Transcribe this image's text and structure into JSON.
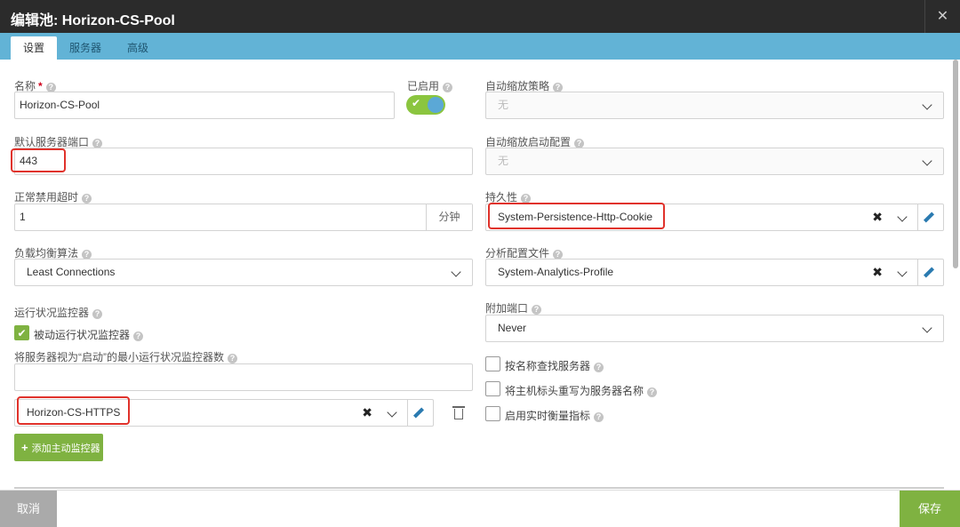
{
  "dialog": {
    "title": "编辑池: Horizon-CS-Pool",
    "close_glyph": "✕"
  },
  "tabs": [
    {
      "label": "设置",
      "active": true
    },
    {
      "label": "服务器",
      "active": false
    },
    {
      "label": "高级",
      "active": false
    }
  ],
  "form": {
    "name": {
      "label": "名称",
      "required_mark": "*",
      "value": "Horizon-CS-Pool"
    },
    "enabled": {
      "label": "已启用",
      "state": true
    },
    "autoscale_policy": {
      "label": "自动缩放策略",
      "value": "无"
    },
    "default_port": {
      "label": "默认服务器端口",
      "value": "443"
    },
    "autoscale_launch": {
      "label": "自动缩放启动配置",
      "value": "无"
    },
    "disable_timeout": {
      "label": "正常禁用超时",
      "value": "1",
      "unit": "分钟"
    },
    "persistence": {
      "label": "持久性",
      "value": "System-Persistence-Http-Cookie"
    },
    "lb_algorithm": {
      "label": "负载均衡算法",
      "value": "Least Connections"
    },
    "analytics_profile": {
      "label": "分析配置文件",
      "value": "System-Analytics-Profile"
    },
    "health_monitor": {
      "label": "运行状况监控器",
      "passive_label": "被动运行状况监控器",
      "passive_checked": true,
      "min_up_label": "将服务器视为“启动”的最小运行状况监控器数",
      "min_up_value": "",
      "monitor_value": "Horizon-CS-HTTPS",
      "add_label": "添加主动监控器",
      "add_glyph": "+"
    },
    "placement_port": {
      "label": "附加端口",
      "value": "Never"
    },
    "options": [
      {
        "label": "按名称查找服务器",
        "checked": false
      },
      {
        "label": "将主机标头重写为服务器名称",
        "checked": false
      },
      {
        "label": "启用实时衡量指标",
        "checked": false
      }
    ]
  },
  "footer": {
    "cancel_label": "取消",
    "save_label": "保存"
  },
  "colors": {
    "accent_green": "#7fb241",
    "tab_blue": "#62b3d6",
    "highlight_red": "#e0322b",
    "titlebar": "#2b2b2b"
  },
  "icons": [
    "help-icon",
    "chevron-down-icon",
    "clear-icon",
    "edit-icon",
    "trash-icon",
    "check-icon",
    "close-icon",
    "plus-icon"
  ]
}
